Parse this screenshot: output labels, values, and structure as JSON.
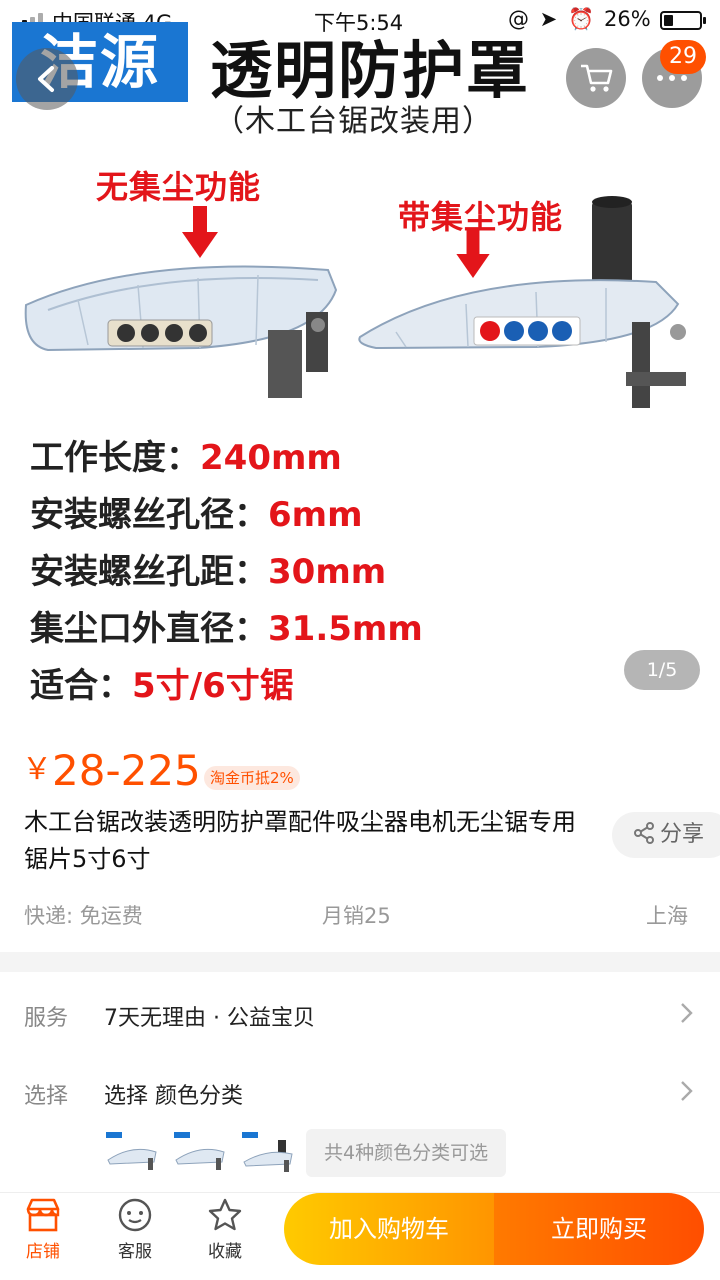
{
  "status_bar": {
    "carrier": "中国联通  4G",
    "time": "下午5:54",
    "system_icons": "@ ➤ ⏰",
    "battery": "26%"
  },
  "product_image": {
    "brand": "洁源",
    "title": "透明防护罩",
    "subtitle": "（木工台锯改装用）",
    "label_without_dust": "无集尘功能",
    "label_with_dust": "带集尘功能",
    "specs": [
      {
        "key": "工作长度：",
        "value": "240mm"
      },
      {
        "key": "安装螺丝孔径：",
        "value": "6mm"
      },
      {
        "key": "安装螺丝孔距：",
        "value": "30mm"
      },
      {
        "key": "集尘口外直径：",
        "value": "31.5mm"
      },
      {
        "key": "适合：",
        "value": "5寸/6寸锯"
      }
    ],
    "pager": "1/5"
  },
  "header": {
    "more_badge": "29",
    "icons": {
      "back": "chevron-left-icon",
      "cart": "cart-icon",
      "more": "more-dots-icon"
    }
  },
  "product": {
    "currency": "￥",
    "price": "28-225",
    "coin_tag": "淘金币抵2%",
    "title": "木工台锯改装透明防护罩配件吸尘器电机无尘锯专用锯片5寸6寸",
    "share": "分享",
    "shipping": "快递: 免运费",
    "monthly_sales": "月销25",
    "location": "上海"
  },
  "service": {
    "label": "服务",
    "value": "7天无理由 · 公益宝贝"
  },
  "selection": {
    "label": "选择",
    "value": "选择  颜色分类",
    "sku_count": "共4种颜色分类可选"
  },
  "bottom_bar": {
    "store": "店铺",
    "service": "客服",
    "favorite": "收藏",
    "add_to_cart": "加入购物车",
    "buy_now": "立即购买"
  },
  "colors": {
    "accent": "#ff5000",
    "brand_blue": "#1a76d2",
    "spec_red": "#e3151a",
    "cart_gradient": [
      "#ffca00",
      "#ff9500"
    ],
    "buy_gradient": [
      "#ff7a00",
      "#ff4e00"
    ]
  }
}
